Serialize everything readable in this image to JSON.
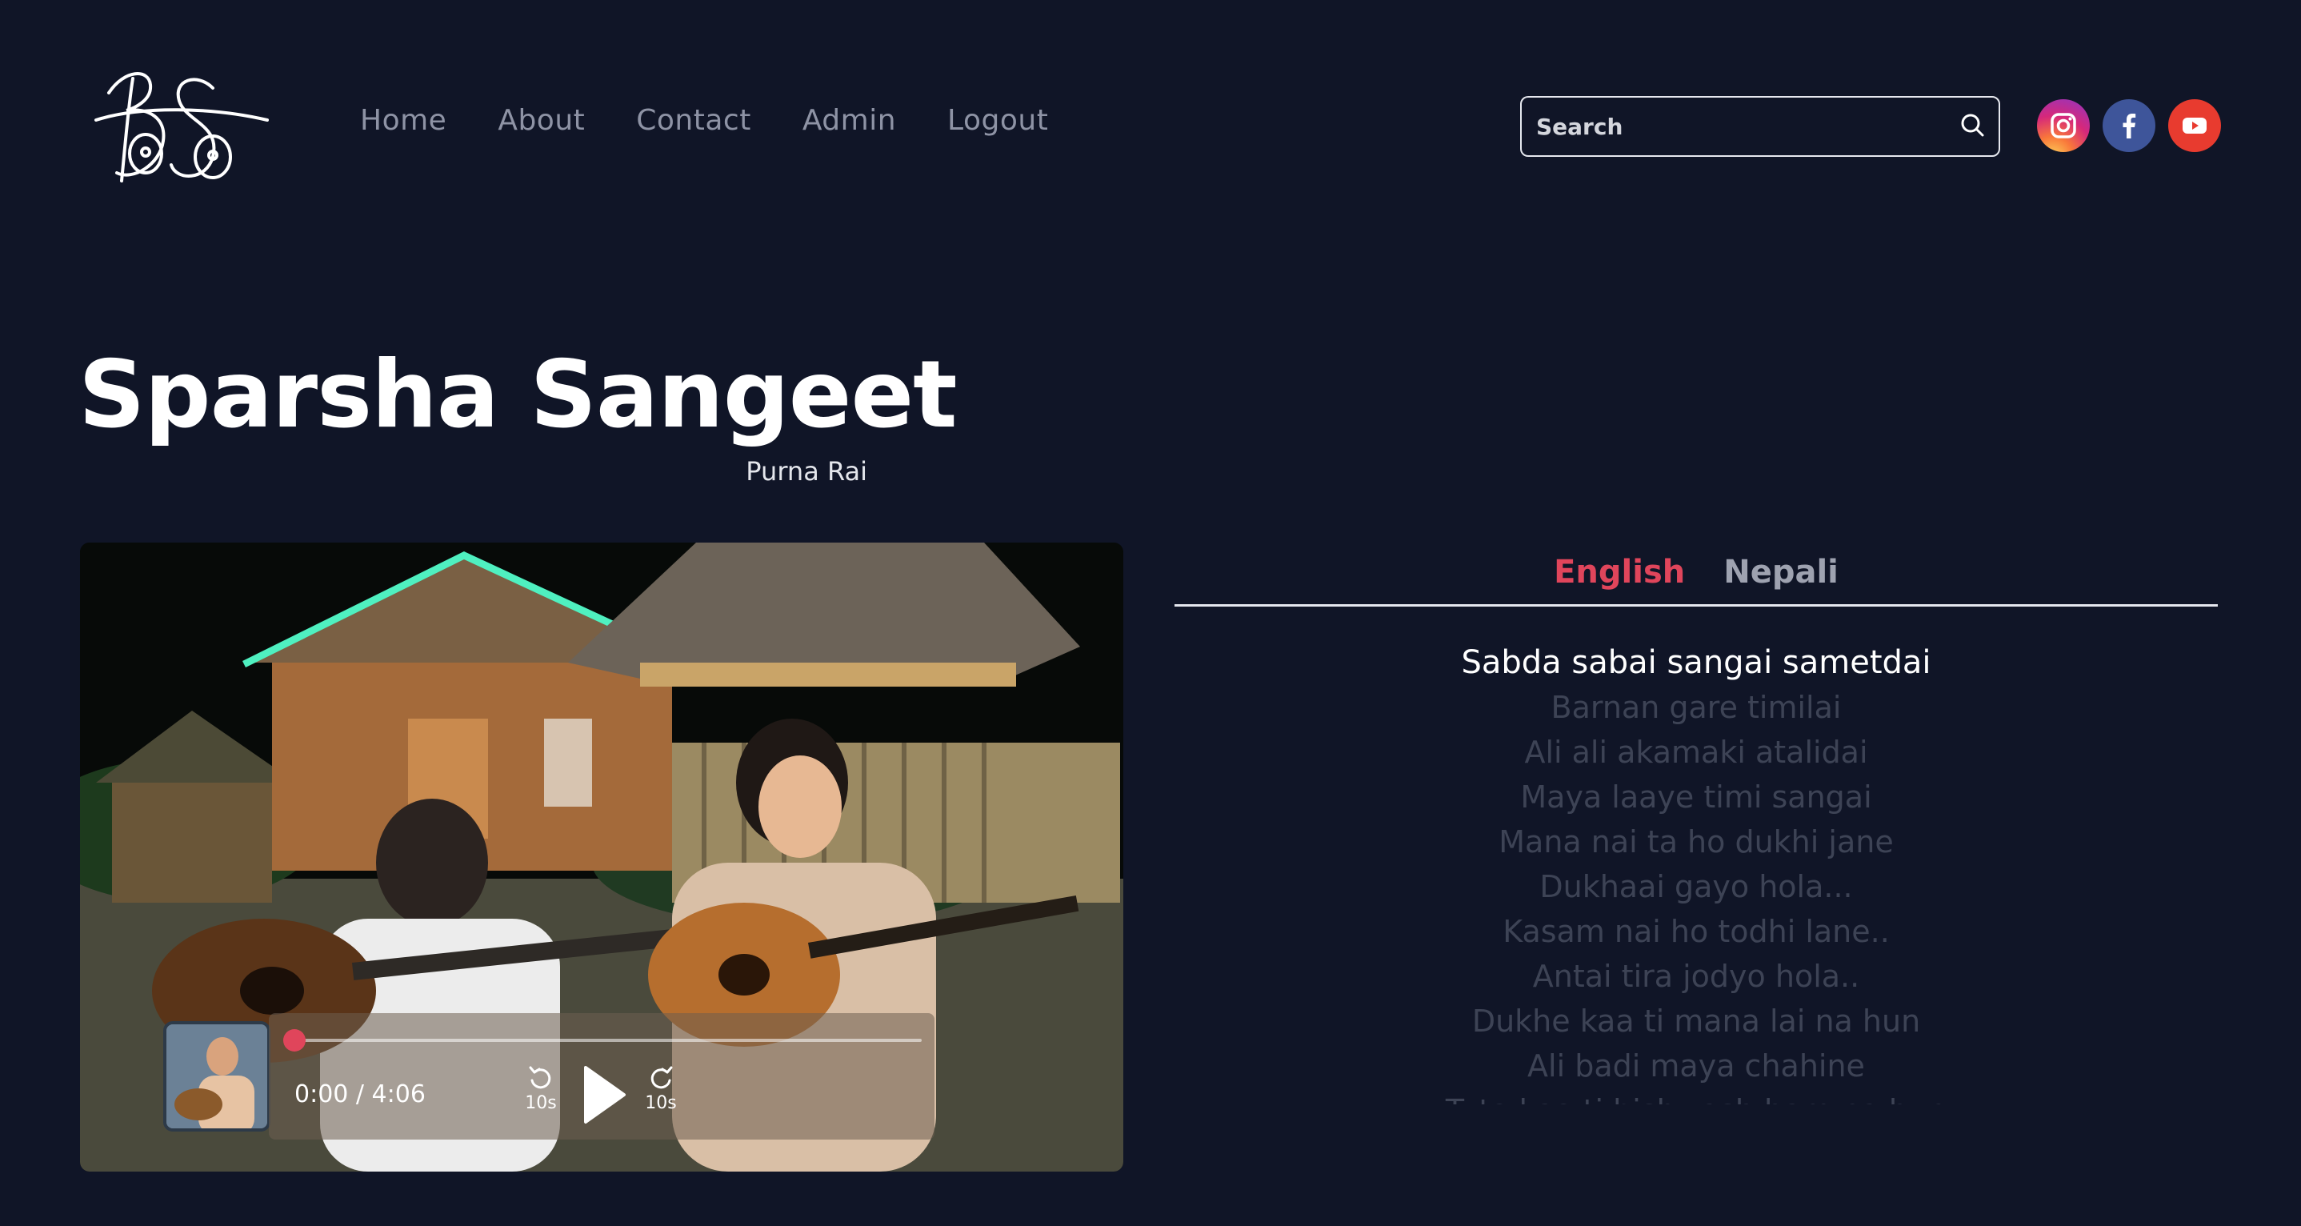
{
  "colors": {
    "background": "#101527",
    "accent": "#e0455b",
    "nav_text": "#8e93a5",
    "dim_lyric": "#3d4355"
  },
  "logo": {
    "alt": "BS"
  },
  "nav": {
    "items": [
      {
        "label": "Home"
      },
      {
        "label": "About"
      },
      {
        "label": "Contact"
      },
      {
        "label": "Admin"
      },
      {
        "label": "Logout"
      }
    ]
  },
  "search": {
    "placeholder": "Search",
    "value": "",
    "icon": "search-icon"
  },
  "socials": [
    {
      "name": "instagram",
      "icon": "instagram-icon"
    },
    {
      "name": "facebook",
      "icon": "facebook-icon"
    },
    {
      "name": "youtube",
      "icon": "youtube-icon"
    }
  ],
  "song": {
    "title": "Sparsha Sangeet",
    "artist": "Purna Rai"
  },
  "player": {
    "current_time": "0:00",
    "separator": " / ",
    "duration": "4:06",
    "time_display": "0:00 / 4:06",
    "progress": 0,
    "rewind_label": "10s",
    "forward_label": "10s",
    "state": "paused"
  },
  "lyrics_panel": {
    "tabs": [
      {
        "label": "English",
        "active": true
      },
      {
        "label": "Nepali",
        "active": false
      }
    ],
    "current_line_index": 0,
    "lines": [
      "Sabda sabai sangai sametdai",
      "Barnan gare timilai",
      "Ali ali akamaki atalidai",
      "Maya laaye timi sangai",
      "Mana nai ta ho dukhi jane",
      "Dukhaai gayo hola...",
      "Kasam nai ho todhi lane..",
      "Antai tira jodyo hola..",
      "Dukhe kaa ti mana lai na hun",
      "Ali badi maya chahine",
      "Tuta kaa ti bishwash ham na hun"
    ]
  }
}
